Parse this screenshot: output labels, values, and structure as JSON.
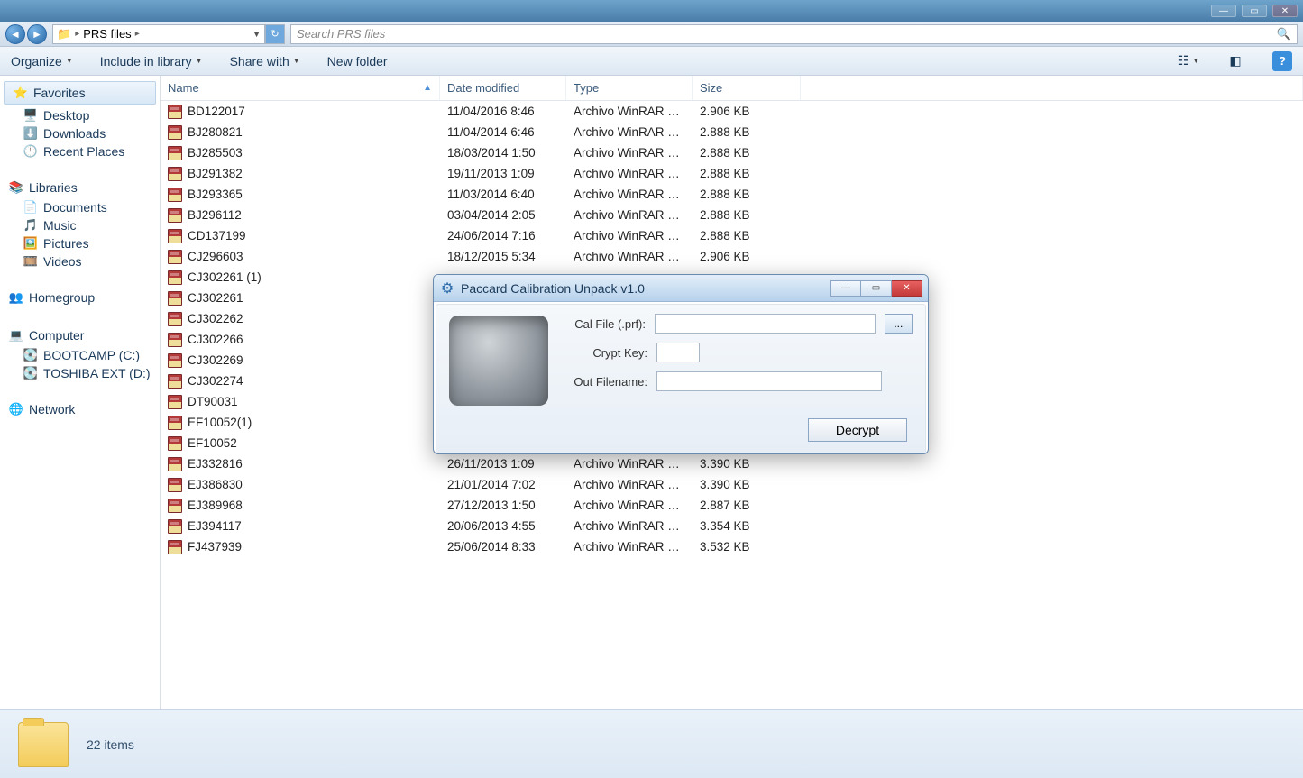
{
  "titlebar": {},
  "address": {
    "folder_label": "PRS files",
    "search_placeholder": "Search PRS files"
  },
  "toolbar": {
    "organize": "Organize",
    "include": "Include in library",
    "share": "Share with",
    "newfolder": "New folder"
  },
  "sidebar": {
    "favorites": "Favorites",
    "fav_items": [
      "Desktop",
      "Downloads",
      "Recent Places"
    ],
    "libraries": "Libraries",
    "lib_items": [
      "Documents",
      "Music",
      "Pictures",
      "Videos"
    ],
    "homegroup": "Homegroup",
    "computer": "Computer",
    "drives": [
      "BOOTCAMP (C:)",
      "TOSHIBA EXT (D:)"
    ],
    "network": "Network"
  },
  "columns": {
    "name": "Name",
    "date": "Date modified",
    "type": "Type",
    "size": "Size"
  },
  "type_label": "Archivo WinRAR ZIP",
  "files": [
    {
      "name": "BD122017",
      "date": "11/04/2016 8:46",
      "size": "2.906 KB"
    },
    {
      "name": "BJ280821",
      "date": "11/04/2014 6:46",
      "size": "2.888 KB"
    },
    {
      "name": "BJ285503",
      "date": "18/03/2014 1:50",
      "size": "2.888 KB"
    },
    {
      "name": "BJ291382",
      "date": "19/11/2013 1:09",
      "size": "2.888 KB"
    },
    {
      "name": "BJ293365",
      "date": "11/03/2014 6:40",
      "size": "2.888 KB"
    },
    {
      "name": "BJ296112",
      "date": "03/04/2014 2:05",
      "size": "2.888 KB"
    },
    {
      "name": "CD137199",
      "date": "24/06/2014 7:16",
      "size": "2.888 KB"
    },
    {
      "name": "CJ296603",
      "date": "18/12/2015 5:34",
      "size": "2.906 KB"
    },
    {
      "name": "CJ302261 (1)",
      "date": "",
      "size": ""
    },
    {
      "name": "CJ302261",
      "date": "",
      "size": ""
    },
    {
      "name": "CJ302262",
      "date": "",
      "size": ""
    },
    {
      "name": "CJ302266",
      "date": "",
      "size": ""
    },
    {
      "name": "CJ302269",
      "date": "",
      "size": ""
    },
    {
      "name": "CJ302274",
      "date": "",
      "size": ""
    },
    {
      "name": "DT90031",
      "date": "",
      "size": ""
    },
    {
      "name": "EF10052(1)",
      "date": "",
      "size": ""
    },
    {
      "name": "EF10052",
      "date": "",
      "size": ""
    },
    {
      "name": "EJ332816",
      "date": "26/11/2013 1:09",
      "size": "3.390 KB"
    },
    {
      "name": "EJ386830",
      "date": "21/01/2014 7:02",
      "size": "3.390 KB"
    },
    {
      "name": "EJ389968",
      "date": "27/12/2013 1:50",
      "size": "2.887 KB"
    },
    {
      "name": "EJ394117",
      "date": "20/06/2013 4:55",
      "size": "3.354 KB"
    },
    {
      "name": "FJ437939",
      "date": "25/06/2014 8:33",
      "size": "3.532 KB"
    }
  ],
  "status": {
    "count_text": "22 items"
  },
  "dialog": {
    "title": "Paccard Calibration Unpack v1.0",
    "cal_label": "Cal File (.prf):",
    "crypt_label": "Crypt Key:",
    "out_label": "Out Filename:",
    "browse": "...",
    "decrypt": "Decrypt",
    "cal_value": "",
    "crypt_value": "",
    "out_value": ""
  }
}
